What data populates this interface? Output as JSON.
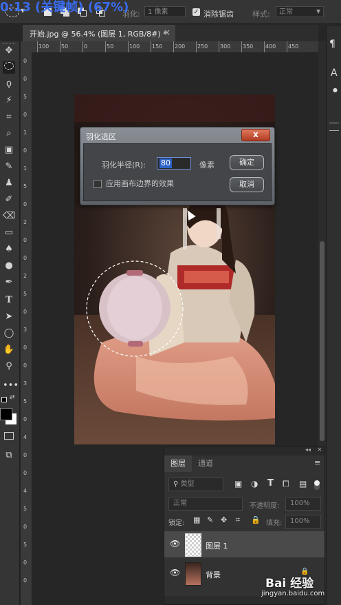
{
  "overlay": {
    "title": "0:13 (关键帧) (67%)"
  },
  "options_bar": {
    "feather_label": "羽化:",
    "feather_value": "1 像素",
    "antialias_label": "消除锯齿",
    "style_label": "样式:",
    "style_value": "正常"
  },
  "document_tab": {
    "title": "开始.jpg @ 56.4% (图层 1, RGB/8#) *",
    "close": "×"
  },
  "rulers": {
    "h_ticks": [
      "100",
      "50",
      "0",
      "50",
      "100",
      "150",
      "200",
      "250",
      "300",
      "350",
      "400",
      "450"
    ],
    "v_ticks": [
      "0",
      "0",
      "5",
      "0",
      "1",
      "0",
      "1",
      "5",
      "0",
      "2",
      "0",
      "0",
      "2",
      "5",
      "0",
      "3",
      "0",
      "0",
      "3",
      "5",
      "0",
      "4",
      "0",
      "0",
      "4",
      "5",
      "0",
      "5",
      "0",
      "0"
    ]
  },
  "dialog": {
    "title": "羽化选区",
    "close": "x",
    "radius_label": "羽化半径(R):",
    "radius_value": "80",
    "unit": "像素",
    "apply_canvas_label": "应用画布边界的效果",
    "ok": "确定",
    "cancel": "取消"
  },
  "layers_panel": {
    "tab_layers": "图层",
    "tab_channels": "通道",
    "filter_kind": "类型",
    "blend_mode": "正常",
    "opacity_label": "不透明度:",
    "opacity_value": "100%",
    "lock_label": "锁定:",
    "fill_label": "填充:",
    "fill_value": "100%",
    "layers": [
      {
        "name": "图层 1",
        "selected": true
      },
      {
        "name": "背景",
        "selected": false
      }
    ]
  },
  "watermark": {
    "brand": "Bai 经验",
    "url": "jingyan.baidu.com"
  },
  "colors": {
    "accent_blue": "#2e64c8",
    "dialog_close": "#c8452a",
    "panel_bg": "#323232"
  }
}
